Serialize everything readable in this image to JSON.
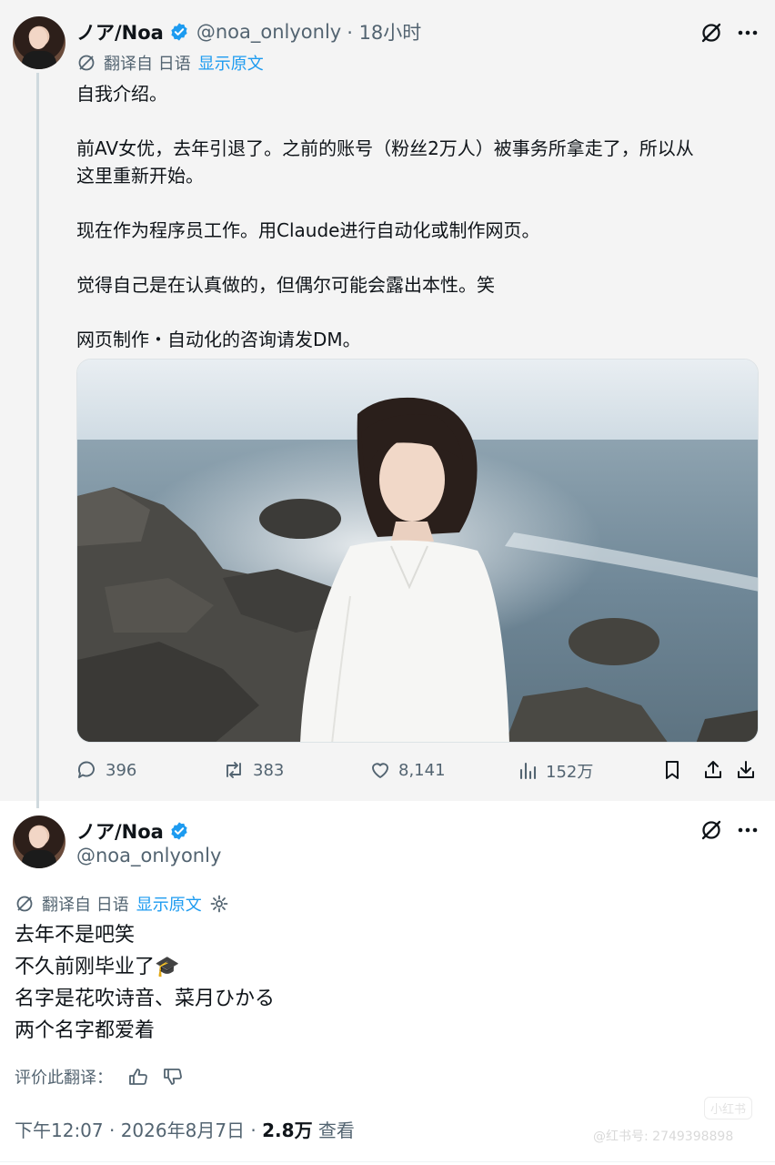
{
  "tweet1": {
    "name": "ノア/Noa",
    "handle": "@noa_onlyonly",
    "time": "· 18小时",
    "translate": {
      "label": "翻译自 日语",
      "link": "显示原文"
    },
    "lines": [
      "自我介绍。",
      "",
      "前AV女优，去年引退了。之前的账号（粉丝2万人）被事务所拿走了，所以从",
      "这里重新开始。",
      "",
      "现在作为程序员工作。用Claude进行自动化或制作网页。",
      "",
      "觉得自己是在认真做的，但偶尔可能会露出本性。笑",
      "",
      "网页制作・自动化的咨询请发DM。"
    ],
    "actions": {
      "replies": "396",
      "reposts": "383",
      "likes": "8,141",
      "views": "152万"
    }
  },
  "tweet2": {
    "name": "ノア/Noa",
    "handle": "@noa_onlyonly",
    "translate": {
      "label": "翻译自 日语",
      "link": "显示原文"
    },
    "lines": [
      "去年不是吧笑",
      "不久前刚毕业了🎓",
      "名字是花吹诗音、菜月ひかる",
      "两个名字都爱着"
    ],
    "rate_label": "评价此翻译：",
    "meta": {
      "time": "下午12:07 · 2026年8月7日 · ",
      "views_count": "2.8万",
      "views_label": " 查看"
    }
  },
  "watermark": {
    "badge": "小红书",
    "id": "@红书号: 2749398898"
  },
  "colors": {
    "accent": "#1d9bf0",
    "muted": "#536471",
    "text": "#0f1419"
  },
  "icons": [
    "grok-icon",
    "more-icon",
    "translate-icon",
    "reply-icon",
    "repost-icon",
    "like-icon",
    "views-icon",
    "bookmark-icon",
    "share-icon",
    "download-icon",
    "settings-icon",
    "thumbs-up-icon",
    "thumbs-down-icon",
    "verified-icon"
  ]
}
